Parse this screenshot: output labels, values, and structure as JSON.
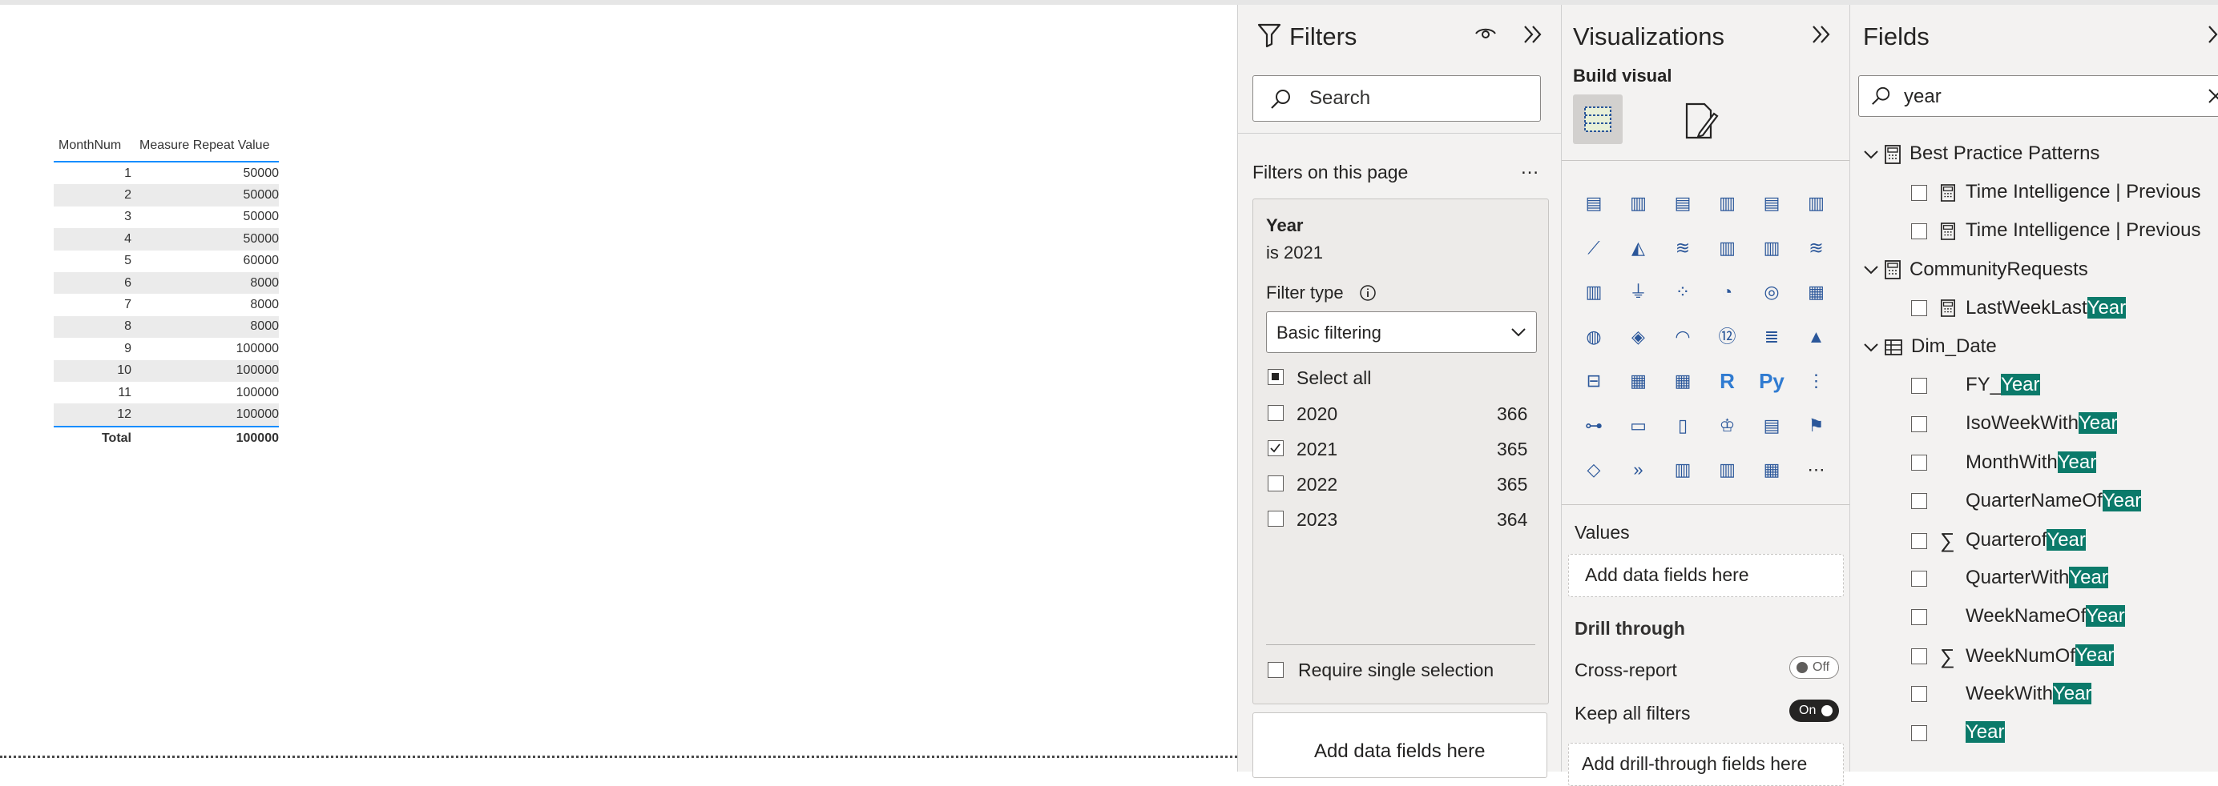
{
  "table": {
    "headers": [
      "MonthNum",
      "Measure Repeat Value"
    ],
    "rows": [
      [
        "1",
        "50000"
      ],
      [
        "2",
        "50000"
      ],
      [
        "3",
        "50000"
      ],
      [
        "4",
        "50000"
      ],
      [
        "5",
        "60000"
      ],
      [
        "6",
        "8000"
      ],
      [
        "7",
        "8000"
      ],
      [
        "8",
        "8000"
      ],
      [
        "9",
        "100000"
      ],
      [
        "10",
        "100000"
      ],
      [
        "11",
        "100000"
      ],
      [
        "12",
        "100000"
      ]
    ],
    "total_label": "Total",
    "total_value": "100000"
  },
  "filters": {
    "title": "Filters",
    "search_placeholder": "Search",
    "section_label": "Filters on this page",
    "more": "…",
    "card": {
      "field": "Year",
      "summary": "is 2021",
      "filter_type_label": "Filter type",
      "filter_type_value": "Basic filtering",
      "select_all": "Select all",
      "options": [
        {
          "label": "2020",
          "count": "366",
          "checked": false
        },
        {
          "label": "2021",
          "count": "365",
          "checked": true
        },
        {
          "label": "2022",
          "count": "365",
          "checked": false
        },
        {
          "label": "2023",
          "count": "364",
          "checked": false
        }
      ],
      "require_single": "Require single selection"
    },
    "add_fields": "Add data fields here"
  },
  "viz": {
    "title": "Visualizations",
    "build_visual": "Build visual",
    "values_label": "Values",
    "add_data_fields": "Add data fields here",
    "drill_through": "Drill through",
    "cross_report": "Cross-report",
    "cross_report_state": "Off",
    "keep_all_filters": "Keep all filters",
    "keep_all_state": "On",
    "add_drill": "Add drill-through fields here",
    "icons": [
      "stacked-bar",
      "stacked-column",
      "clustered-bar",
      "clustered-column",
      "100-bar",
      "100-column",
      "line",
      "area",
      "stacked-area",
      "line-column",
      "line-clustered",
      "ribbon",
      "waterfall",
      "funnel",
      "scatter",
      "pie",
      "donut",
      "treemap",
      "map",
      "filled-map",
      "gauge",
      "card",
      "multi-row-card",
      "kpi",
      "slicer",
      "table",
      "matrix",
      "r-visual",
      "python-visual",
      "key-influencers",
      "decomposition-tree",
      "qa",
      "paginated",
      "goals",
      "smart-narrative",
      "azure-map",
      "power-apps",
      "power-automate",
      "charticulator",
      "bullet",
      "mekko",
      "more"
    ]
  },
  "fields": {
    "title": "Fields",
    "search_value": "year",
    "tree": [
      {
        "type": "group",
        "label": "Best Practice Patterns",
        "hl": ""
      },
      {
        "type": "item",
        "calc": true,
        "label": "Time Intelligence | Previous",
        "hl": ""
      },
      {
        "type": "item",
        "calc": true,
        "label": "Time Intelligence | Previous",
        "hl": ""
      },
      {
        "type": "group",
        "label": "CommunityRequests",
        "hl": ""
      },
      {
        "type": "item",
        "calc": true,
        "label": "LastWeekLast",
        "hl": "Year"
      },
      {
        "type": "table",
        "label": "Dim_Date",
        "hl": ""
      },
      {
        "type": "item",
        "label": "FY_",
        "hl": "Year"
      },
      {
        "type": "item",
        "label": "IsoWeekWith",
        "hl": "Year"
      },
      {
        "type": "item",
        "label": "MonthWith",
        "hl": "Year"
      },
      {
        "type": "item",
        "label": "QuarterNameOf",
        "hl": "Year"
      },
      {
        "type": "item",
        "sigma": true,
        "label": "Quarterof",
        "hl": "Year"
      },
      {
        "type": "item",
        "label": "QuarterWith",
        "hl": "Year"
      },
      {
        "type": "item",
        "label": "WeekNameOf",
        "hl": "Year"
      },
      {
        "type": "item",
        "sigma": true,
        "label": "WeekNumOf",
        "hl": "Year"
      },
      {
        "type": "item",
        "label": "WeekWith",
        "hl": "Year"
      },
      {
        "type": "item",
        "label": "",
        "hl": "Year"
      }
    ]
  }
}
